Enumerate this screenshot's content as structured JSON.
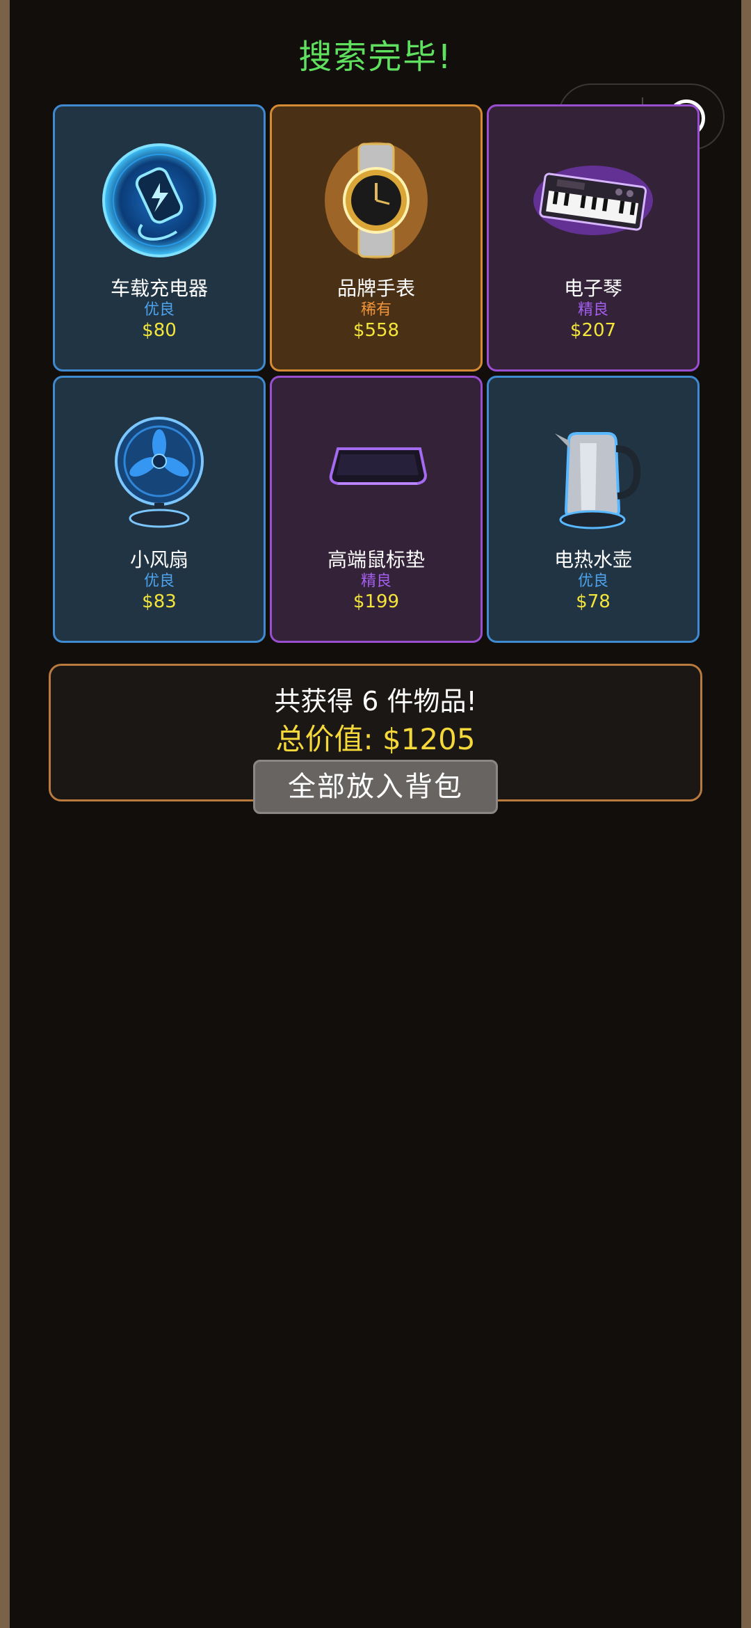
{
  "header": {
    "title": "搜索完毕!"
  },
  "capsule": {
    "more_icon": "more-dots-icon",
    "close_icon": "close-target-icon"
  },
  "items": [
    {
      "name": "车载充电器",
      "rarity": "优良",
      "price": "$80",
      "rarity_class": "good",
      "icon": "car-charger-icon"
    },
    {
      "name": "品牌手表",
      "rarity": "稀有",
      "price": "$558",
      "rarity_class": "rare",
      "icon": "watch-icon"
    },
    {
      "name": "电子琴",
      "rarity": "精良",
      "price": "$207",
      "rarity_class": "epic",
      "icon": "keyboard-piano-icon"
    },
    {
      "name": "小风扇",
      "rarity": "优良",
      "price": "$83",
      "rarity_class": "good",
      "icon": "desk-fan-icon"
    },
    {
      "name": "高端鼠标垫",
      "rarity": "精良",
      "price": "$199",
      "rarity_class": "epic",
      "icon": "mouse-pad-icon"
    },
    {
      "name": "电热水壶",
      "rarity": "优良",
      "price": "$78",
      "rarity_class": "good",
      "icon": "electric-kettle-icon"
    }
  ],
  "summary": {
    "count_text": "共获得 6 件物品!",
    "total_text": "总价值: $1205",
    "button_label": "全部放入背包"
  },
  "colors": {
    "title": "#5fe05f",
    "good": "#4ea3ee",
    "rare": "#f0953a",
    "epic": "#a45ef0",
    "price": "#f3e53a",
    "total": "#f5d83a"
  }
}
